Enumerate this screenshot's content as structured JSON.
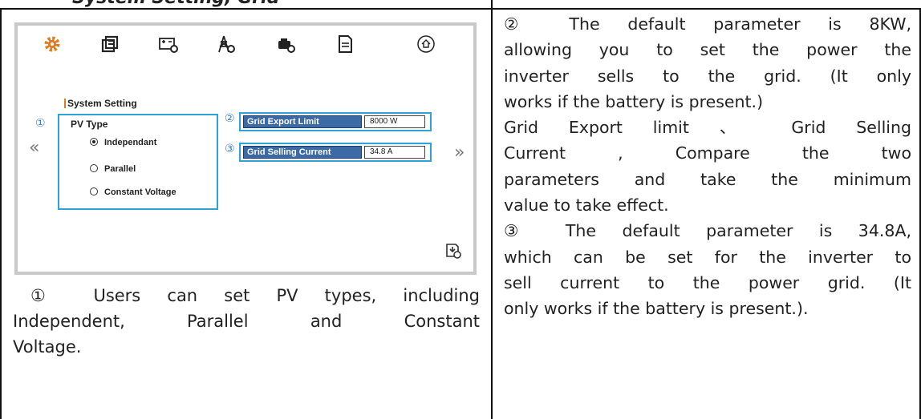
{
  "header": {
    "title": "System Setting, Grid"
  },
  "screen": {
    "toolbar": [
      {
        "name": "gear-icon"
      },
      {
        "name": "battery-settings-icon"
      },
      {
        "name": "battery-gear-icon"
      },
      {
        "name": "grid-tower-icon"
      },
      {
        "name": "generator-icon"
      },
      {
        "name": "document-icon"
      },
      {
        "name": "home-icon"
      }
    ],
    "section_title": "System Setting",
    "markers": {
      "one": "①",
      "two": "②",
      "three": "③"
    },
    "pv_type": {
      "label": "PV Type",
      "options": [
        "Independant",
        "Parallel",
        "Constant Voltage"
      ],
      "selected": "Independant"
    },
    "grid_export_limit": {
      "label": "Grid Export Limit",
      "value": "8000  W"
    },
    "grid_selling_current": {
      "label": "Grid Selling Current",
      "value": "34.8  A"
    },
    "nav": {
      "prev": "«",
      "next": "»"
    },
    "colors": {
      "accent_border": "#2fa3d8",
      "label_bg": "#3c6aa6",
      "icon_orange": "#e07a1e"
    }
  },
  "captions": {
    "left": {
      "line1": "① Users can set PV types, including",
      "line2": "Independent, Parallel and Constant",
      "line3": "Voltage."
    },
    "right": [
      "② The default parameter is 8KW,",
      "allowing you to set the power the",
      "inverter sells to the grid. (It only",
      "works if the battery is present.)",
      "Grid Export limit 、 Grid Selling",
      "Current , Compare the two",
      "parameters and take the minimum",
      "value to take effect.",
      "③ The default parameter is 34.8A,",
      "which can be set for the inverter to",
      "sell current to the power grid. (It",
      "only works if the battery is present.)."
    ]
  }
}
